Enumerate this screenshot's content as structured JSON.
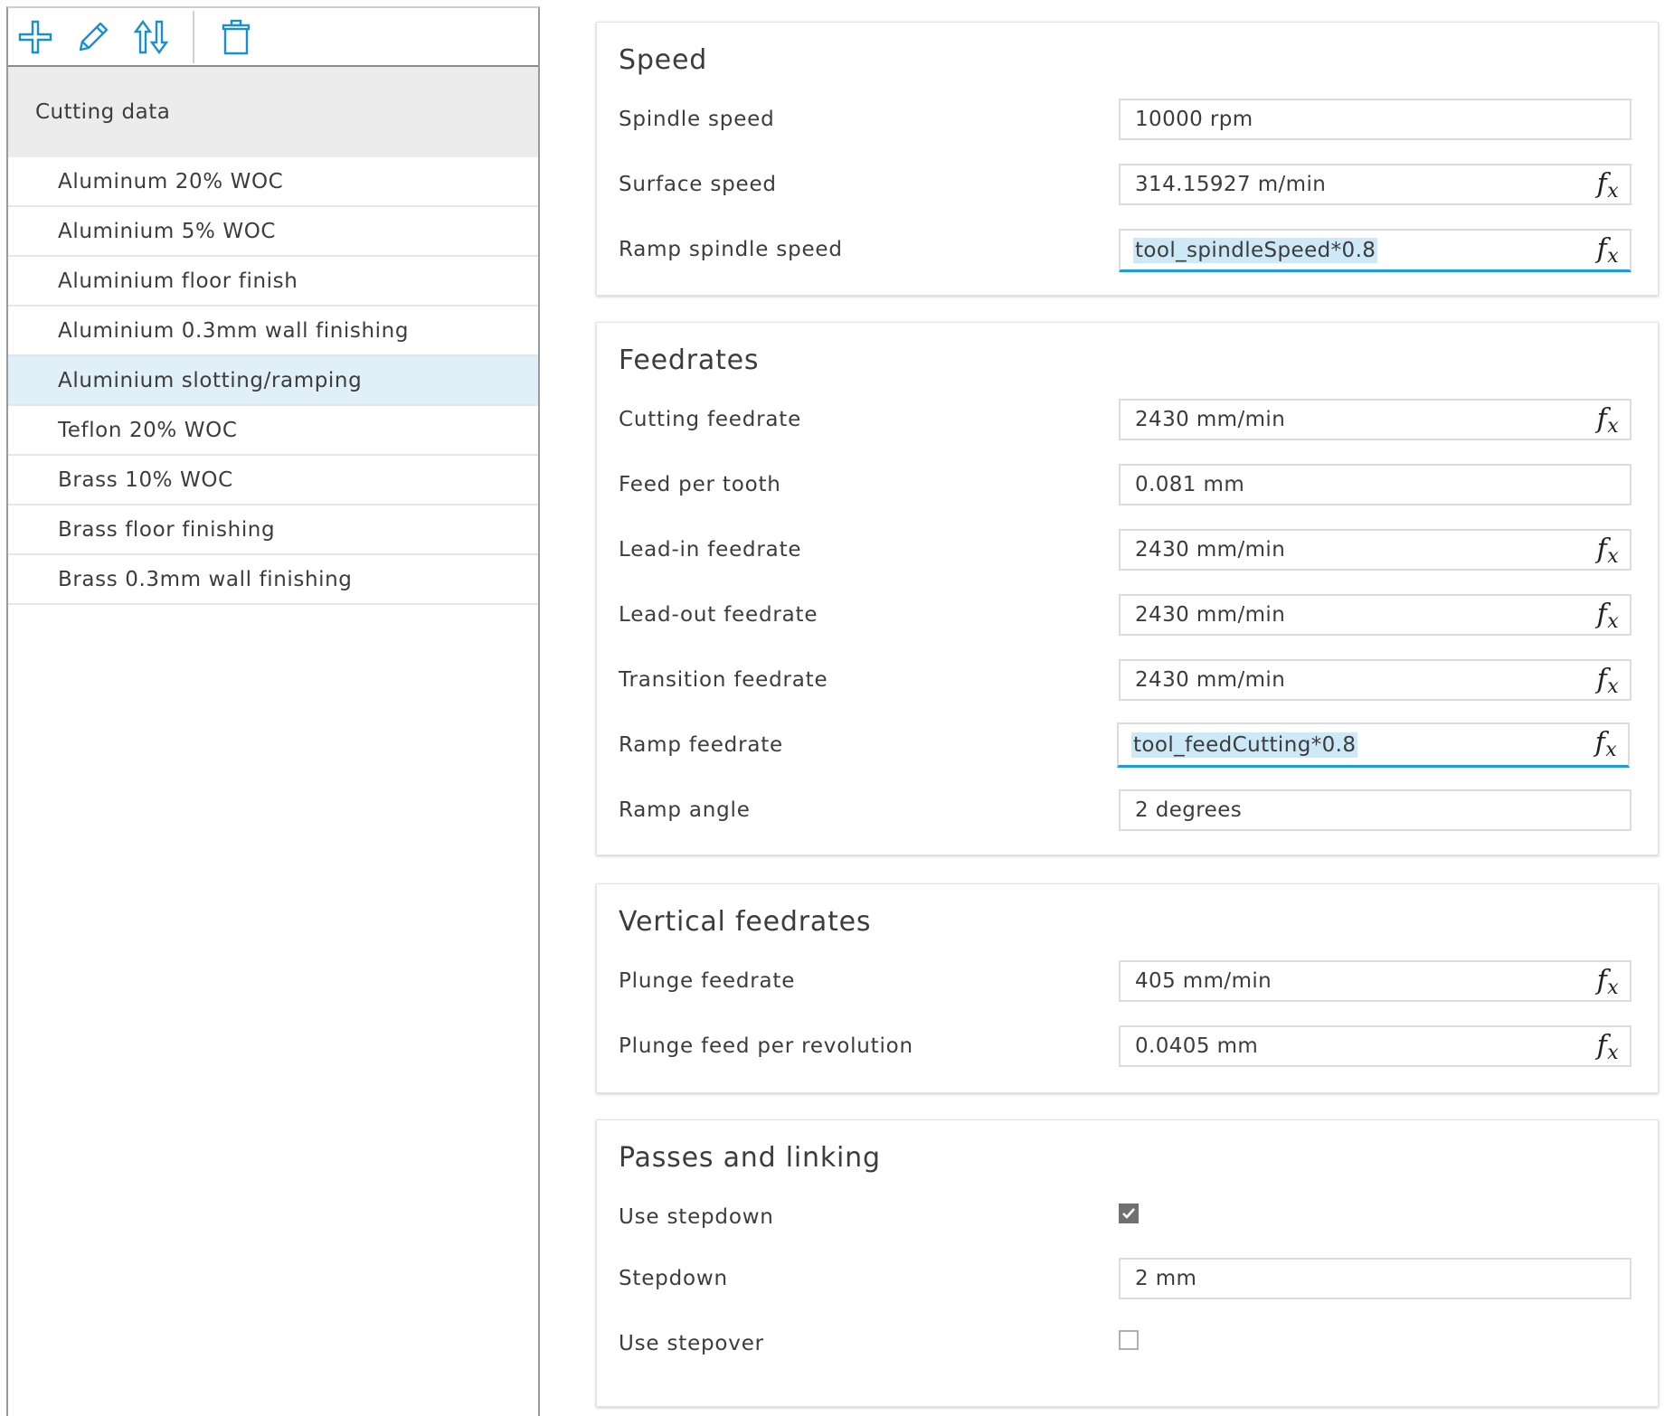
{
  "toolbar": {
    "add_icon": "plus-icon",
    "edit_icon": "pencil-icon",
    "sort_icon": "sort-arrows-icon",
    "delete_icon": "trash-icon",
    "accent_color": "#1a8fd0"
  },
  "sidebar": {
    "header": "Cutting data",
    "selected_index": 4,
    "items": [
      {
        "label": "Aluminum 20% WOC"
      },
      {
        "label": "Aluminium 5% WOC"
      },
      {
        "label": "Aluminium floor finish"
      },
      {
        "label": "Aluminium 0.3mm wall finishing"
      },
      {
        "label": "Aluminium slotting/ramping"
      },
      {
        "label": "Teflon 20% WOC"
      },
      {
        "label": "Brass 10% WOC"
      },
      {
        "label": "Brass floor finishing"
      },
      {
        "label": "Brass 0.3mm wall finishing"
      }
    ]
  },
  "fx_label": "f",
  "fx_sub": "x",
  "speed": {
    "title": "Speed",
    "rows": [
      {
        "label": "Spindle speed",
        "value": "10000 rpm"
      },
      {
        "label": "Surface speed",
        "value": "314.15927 m/min"
      },
      {
        "label": "Ramp spindle speed",
        "value": "tool_spindleSpeed*0.8"
      }
    ]
  },
  "feedrates": {
    "title": "Feedrates",
    "rows": [
      {
        "label": "Cutting feedrate",
        "value": "2430 mm/min"
      },
      {
        "label": "Feed per tooth",
        "value": "0.081 mm"
      },
      {
        "label": "Lead-in feedrate",
        "value": "2430 mm/min"
      },
      {
        "label": "Lead-out feedrate",
        "value": "2430 mm/min"
      },
      {
        "label": "Transition feedrate",
        "value": "2430 mm/min"
      },
      {
        "label": "Ramp feedrate",
        "value": "tool_feedCutting*0.8"
      },
      {
        "label": "Ramp angle",
        "value": "2 degrees"
      }
    ]
  },
  "vertical_feedrates": {
    "title": "Vertical feedrates",
    "rows": [
      {
        "label": "Plunge feedrate",
        "value": "405 mm/min"
      },
      {
        "label": "Plunge feed per revolution",
        "value": "0.0405 mm"
      }
    ]
  },
  "passes_linking": {
    "title": "Passes and linking",
    "rows": [
      {
        "label": "Use stepdown",
        "checked": true
      },
      {
        "label": "Stepdown",
        "value": "2 mm"
      },
      {
        "label": "Use stepover",
        "checked": false
      }
    ]
  }
}
